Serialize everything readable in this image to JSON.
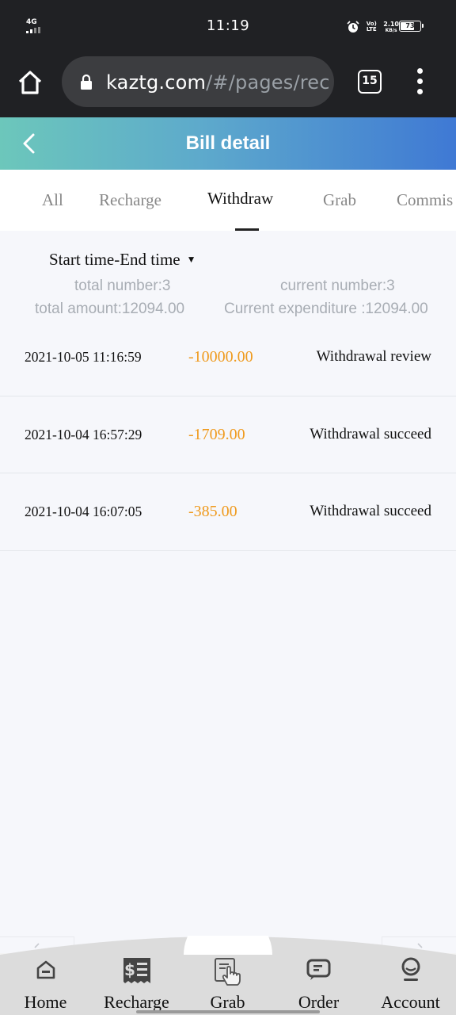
{
  "status_bar": {
    "network": "4G",
    "time": "11:19",
    "volte": "Vo) LTE",
    "speed_value": "2.10",
    "speed_unit": "KB/s",
    "battery": "73"
  },
  "browser": {
    "url_host": "kaztg.com",
    "url_path": "/#/pages/rec",
    "tab_count": "15"
  },
  "header": {
    "title": "Bill detail"
  },
  "tabs": [
    {
      "label": "All",
      "active": false
    },
    {
      "label": "Recharge",
      "active": false
    },
    {
      "label": "Withdraw",
      "active": true
    },
    {
      "label": "Grab",
      "active": false
    },
    {
      "label": "Commis",
      "active": false
    }
  ],
  "filter": {
    "label": "Start time-End time"
  },
  "summary": {
    "total_number": "total number:3",
    "current_number": "current number:3",
    "total_amount": "total amount:12094.00",
    "current_expenditure": "Current expenditure :12094.00"
  },
  "bills": [
    {
      "time": "2021-10-05 11:16:59",
      "amount": "-10000.00",
      "status": "Withdrawal review"
    },
    {
      "time": "2021-10-04 16:57:29",
      "amount": "-1709.00",
      "status": "Withdrawal succeed"
    },
    {
      "time": "2021-10-04 16:07:05",
      "amount": "-385.00",
      "status": "Withdrawal succeed"
    }
  ],
  "bottom_nav": [
    {
      "label": "Home",
      "icon": "home-icon"
    },
    {
      "label": "Recharge",
      "icon": "recharge-receipt-icon"
    },
    {
      "label": "Grab",
      "icon": "grab-hand-icon"
    },
    {
      "label": "Order",
      "icon": "order-icon"
    },
    {
      "label": "Account",
      "icon": "account-icon"
    }
  ],
  "colors": {
    "header_gradient_start": "#6cc7bb",
    "header_gradient_end": "#3f79d4",
    "amount": "#ef9a1d",
    "page_bg": "#f6f7fb"
  }
}
